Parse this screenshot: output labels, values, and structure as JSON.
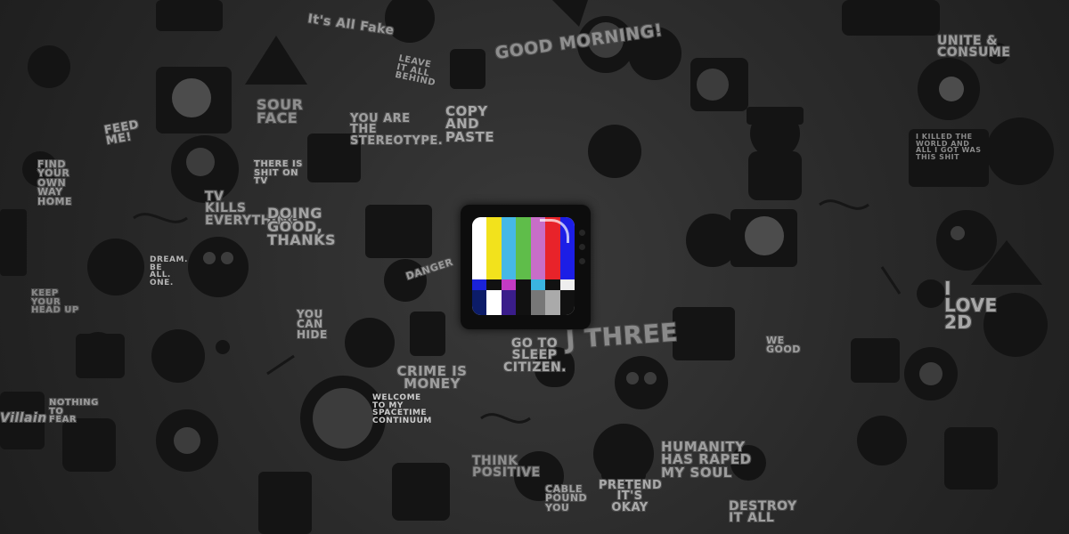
{
  "wallpaper": {
    "stickers": [
      "GOOD MORNING!",
      "UNITE & CONSUME",
      "YOU ARE THE STEREOTYPE.",
      "COPY AND PASTE",
      "It's All Fake",
      "FEED ME!",
      "FIND YOUR OWN WAY HOME",
      "TV KILLS EVERYTHING",
      "DOING GOOD, THANKS",
      "THERE IS SHIT ON TV",
      "KEEP YOUR HEAD UP",
      "DANGER",
      "YOU CAN HIDE",
      "CRIME IS MONEY",
      "GO TO SLEEP CITIZEN.",
      "J THREE",
      "WE GOOD",
      "I LOVE 2D",
      "HUMANITY HAS RAPED MY SOUL",
      "PRETEND IT'S OKAY",
      "THINK POSITIVE",
      "DESTROY IT ALL",
      "NOTHING TO FEAR",
      "Villain",
      "WELCOME TO MY SPACETIME CONTINUUM",
      "I KILLED THE WORLD AND ALL I GOT WAS THIS SHIT",
      "CABLE POUND YOU",
      "DREAM. BE ALL. ONE.",
      "LEAVE IT ALL BEHIND",
      "SOUR FACE"
    ]
  },
  "tv_icon": {
    "colors": {
      "bars": [
        "#ffffff",
        "#f2e21c",
        "#46b8e6",
        "#5fbd4a",
        "#c86ec8",
        "#e8232a",
        "#1c1ee6"
      ],
      "middle_band": [
        "#1a22d8",
        "#111111",
        "#c43ac4",
        "#111111",
        "#3ab4e0",
        "#111111",
        "#eeeeee"
      ],
      "bottom_band": [
        "#0c1c68",
        "#ffffff",
        "#3a1d8a",
        "#111111",
        "#777777",
        "#aaaaaa",
        "#111111"
      ],
      "frame": "#0d0d0d"
    }
  }
}
